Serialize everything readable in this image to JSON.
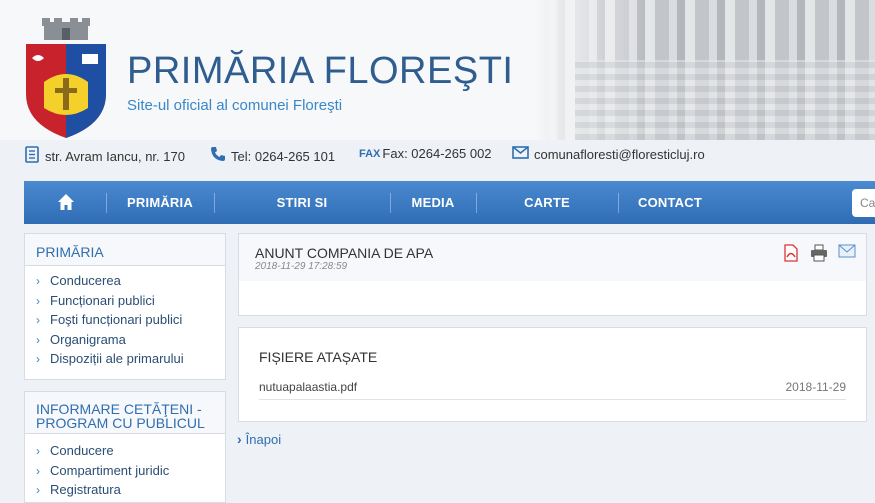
{
  "header": {
    "title": "PRIMĂRIA FLOREŞTI",
    "subtitle": "Site-ul oficial al comunei Floreşti"
  },
  "contacts": {
    "address": "str. Avram Iancu, nr. 170",
    "phone": "Tel: 0264-265 101",
    "fax_tag": "FAX",
    "fax": "Fax: 0264-265 002",
    "email": "comunafloresti@floresticluj.ro"
  },
  "nav": {
    "items": [
      "PRIMĂRIA",
      "STIRI SI EVENIMENTE",
      "MEDIA",
      "CARTE OASPETI",
      "CONTACT"
    ],
    "search_placeholder": "Ca"
  },
  "sidebar": {
    "section1": {
      "title": "PRIMĂRIA",
      "items": [
        "Conducerea",
        "Funcționari publici",
        "Foşti funcționari publici",
        "Organigrama",
        "Dispoziții ale primarului"
      ]
    },
    "section2": {
      "title_line1": "INFORMARE CETĂŢENI -",
      "title_line2": "PROGRAM CU PUBLICUL",
      "items": [
        "Conducere",
        "Compartiment juridic",
        "Registratura"
      ]
    }
  },
  "article": {
    "title": "ANUNT COMPANIA DE APA",
    "date": "2018-11-29 17:28:59"
  },
  "attachments": {
    "title": "FIȘIERE ATAȘATE",
    "files": [
      {
        "name": "nutuapalaastia.pdf",
        "date": "2018-11-29"
      }
    ]
  },
  "back_link": "Înapoi",
  "colors": {
    "brand": "#2f5d8f",
    "accent": "#3a86c8",
    "nav": "#3b7cc5"
  }
}
